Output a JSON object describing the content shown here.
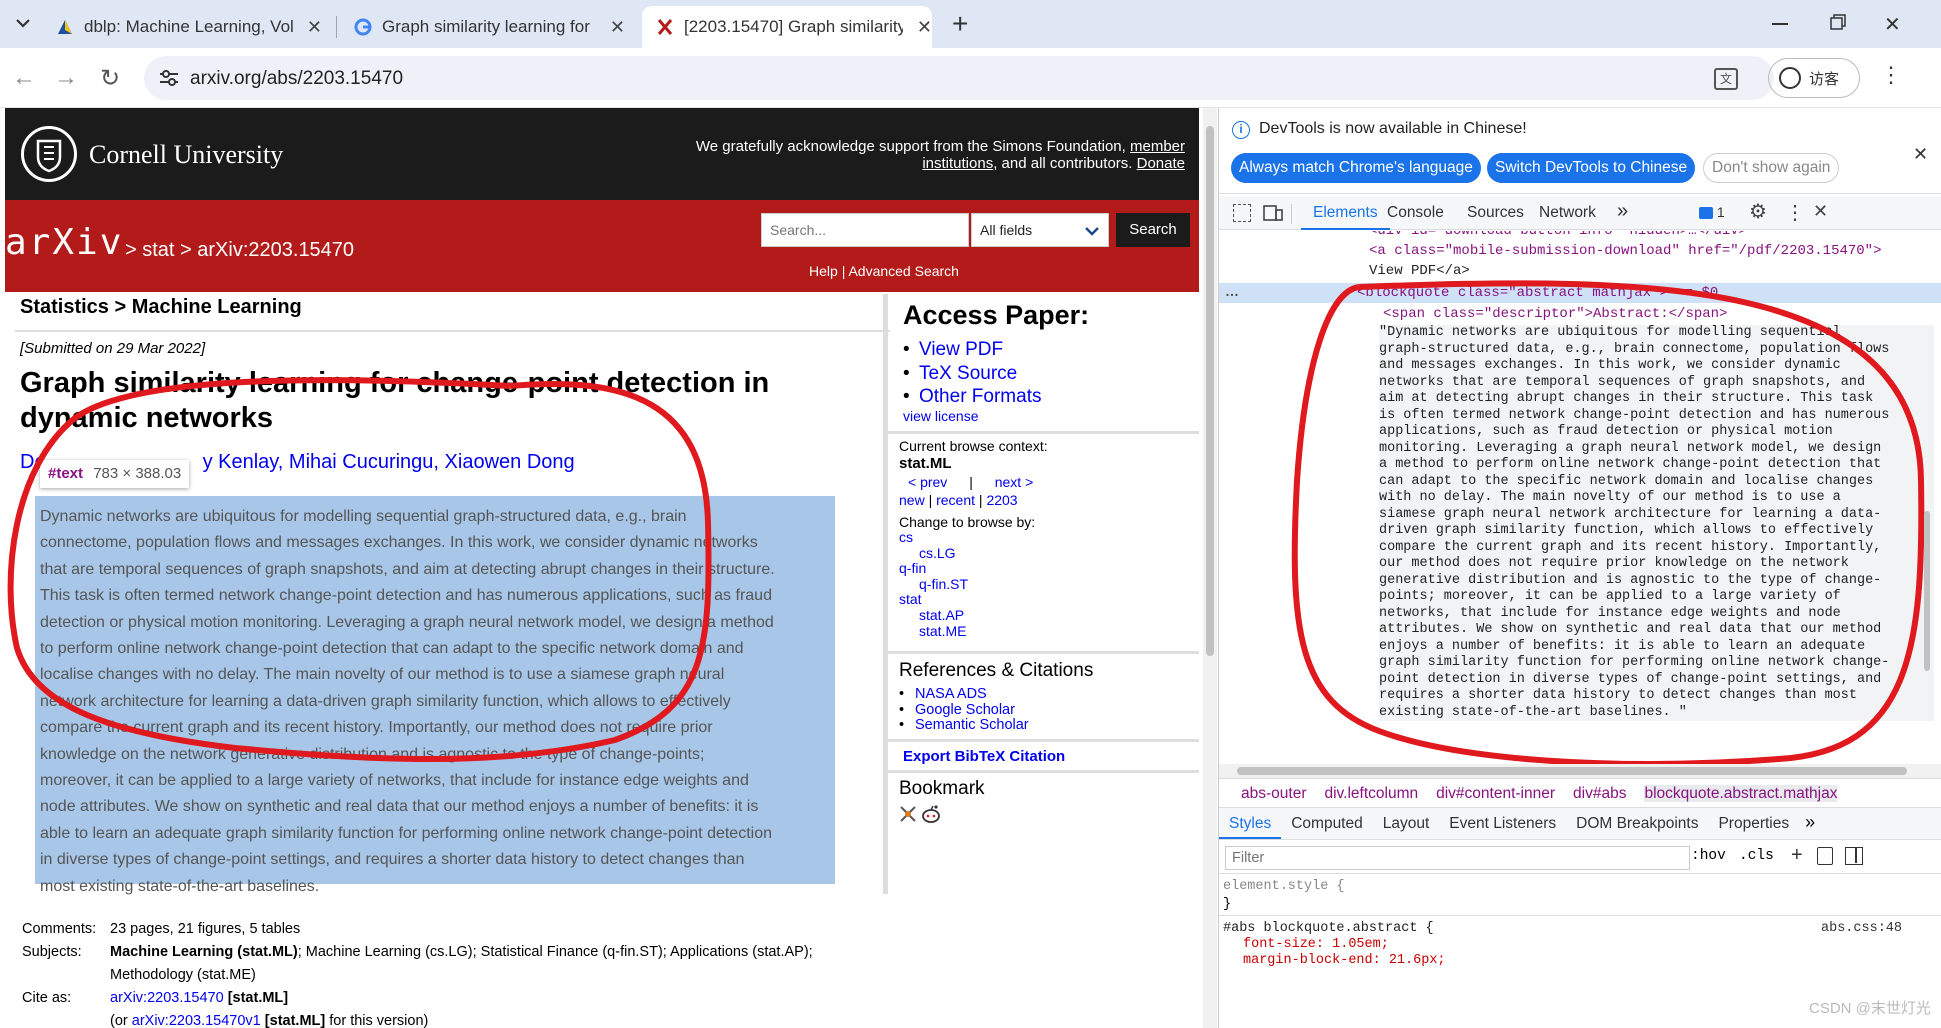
{
  "browser": {
    "tabs": [
      {
        "title": "dblp: Machine Learning, Volu",
        "active": false
      },
      {
        "title": "Graph similarity learning for",
        "active": false
      },
      {
        "title": "[2203.15470] Graph similarity",
        "active": true
      }
    ],
    "url": "arxiv.org/abs/2203.15470",
    "guest_label": "访客",
    "new_tab": "+"
  },
  "page": {
    "cornell_name": "Cornell University",
    "support_text_1": "We gratefully acknowledge support from the Simons Foundation,",
    "support_link_1": "member",
    "support_link_2": "institutions",
    "support_text_2": ", and all contributors.",
    "donate": "Donate",
    "arxiv_logo": "arXiv",
    "breadcrumb": "> stat > arXiv:2203.15470",
    "search_placeholder": "Search...",
    "search_field": "All fields",
    "search_button": "Search",
    "help": "Help",
    "help_sep": "|",
    "advanced_search": "Advanced Search",
    "subject_header": "Statistics > Machine Learning",
    "submitted": "[Submitted on 29 Mar 2022]",
    "title": "Graph similarity learning for change-point detection in dynamic networks",
    "authors_prefix": "De",
    "authors_tail": "y Kenlay, Mihai Cucuringu, Xiaowen Dong",
    "inspect_tooltip_tag": "#text",
    "inspect_tooltip_size": "783 × 388.03",
    "abstract": "Dynamic networks are ubiquitous for modelling sequential graph-structured data, e.g., brain connectome, population flows and messages exchanges. In this work, we consider dynamic networks that are temporal sequences of graph snapshots, and aim at detecting abrupt changes in their structure. This task is often termed network change-point detection and has numerous applications, such as fraud detection or physical motion monitoring. Leveraging a graph neural network model, we design a method to perform online network change-point detection that can adapt to the specific network domain and localise changes with no delay. The main novelty of our method is to use a siamese graph neural network architecture for learning a data-driven graph similarity function, which allows to effectively compare the current graph and its recent history. Importantly, our method does not require prior knowledge on the network generative distribution and is agnostic to the type of change-points; moreover, it can be applied to a large variety of networks, that include for instance edge weights and node attributes. We show on synthetic and real data that our method enjoys a number of benefits: it is able to learn an adequate graph similarity function for performing online network change-point detection in diverse types of change-point settings, and requires a shorter data history to detect changes than most existing state-of-the-art baselines.",
    "abstract_lines": [
      "Dynamic networks are ubiquitous for modelling sequential graph-structured data, e.g., brain",
      "connectome, population flows and messages exchanges. In this work, we consider dynamic networks",
      "that are temporal sequences of graph snapshots, and aim at detecting abrupt changes in their structure.",
      "This task is often termed network change-point detection and has numerous applications, such as fraud",
      "detection or physical motion monitoring. Leveraging a graph neural network model, we design a method",
      "to perform online network change-point detection that can adapt to the specific network domain and",
      "localise changes with no delay. The main novelty of our method is to use a siamese graph neural",
      "network architecture for learning a data-driven graph similarity function, which allows to effectively",
      "compare the current graph and its recent history. Importantly, our method does not require prior",
      "knowledge on the network generative distribution and is agnostic to the type of change-points;",
      "moreover, it can be applied to a large variety of networks, that include for instance edge weights and",
      "node attributes. We show on synthetic and real data that our method enjoys a number of benefits: it is",
      "able to learn an adequate graph similarity function for performing online network change-point detection",
      "in diverse types of change-point settings, and requires a shorter data history to detect changes than",
      "most existing state-of-the-art baselines."
    ],
    "meta": {
      "comments_label": "Comments:",
      "comments_value": "23 pages, 21 figures, 5 tables",
      "subjects_label": "Subjects:",
      "subjects_bold": "Machine Learning (stat.ML)",
      "subjects_rest": "; Machine Learning (cs.LG); Statistical Finance (q-fin.ST); Applications (stat.AP);",
      "subjects_line2": "Methodology (stat.ME)",
      "cite_label": "Cite as:",
      "cite_link": "arXiv:2203.15470",
      "cite_bold": "[stat.ML]",
      "cite2_prefix": "(or",
      "cite2_link": "arXiv:2203.15470v1",
      "cite2_bold": "[stat.ML]",
      "cite2_rest": "for this version)"
    },
    "sidebar": {
      "access_title": "Access Paper:",
      "access_links": [
        "View PDF",
        "TeX Source",
        "Other Formats"
      ],
      "view_license": "view license",
      "browse_context_label": "Current browse context:",
      "browse_context": "stat.ML",
      "prev": "< prev",
      "prev_sep": "|",
      "next": "next >",
      "new": "new",
      "recent": "recent",
      "year": "2203",
      "change_browse": "Change to browse by:",
      "browse_items": [
        {
          "text": "cs",
          "indent": false
        },
        {
          "text": "cs.LG",
          "indent": true
        },
        {
          "text": "q-fin",
          "indent": false
        },
        {
          "text": "q-fin.ST",
          "indent": true
        },
        {
          "text": "stat",
          "indent": false
        },
        {
          "text": "stat.AP",
          "indent": true
        },
        {
          "text": "stat.ME",
          "indent": true
        }
      ],
      "refs_title": "References & Citations",
      "refs_links": [
        "NASA ADS",
        "Google Scholar",
        "Semantic Scholar"
      ],
      "export_bibtex": "Export BibTeX Citation",
      "bookmark": "Bookmark"
    }
  },
  "devtools": {
    "banner_text": "DevTools is now available in Chinese!",
    "banner_btn1": "Always match Chrome's language",
    "banner_btn2": "Switch DevTools to Chinese",
    "banner_btn3": "Don't show again",
    "tabs": [
      "Elements",
      "Console",
      "Sources",
      "Network"
    ],
    "more_tabs": "»",
    "issues_count": "1",
    "dom_lines": [
      "<div id=\"download-button-info\" hidden>…</div>",
      "<a class=\"mobile-submission-download\" href=\"/pdf/2203.15470\">",
      "View PDF</a>",
      "<blockquote class=\"abstract mathjax\"> == $0",
      "<span class=\"descriptor\">Abstract:</span>"
    ],
    "dom_text_lines": [
      "\"Dynamic networks are ubiquitous for modelling sequential",
      "graph-structured data, e.g., brain connectome, population flows",
      "and messages exchanges. In this work, we consider dynamic",
      "networks that are temporal sequences of graph snapshots, and",
      "aim at detecting abrupt changes in their structure. This task",
      "is often termed network change-point detection and has numerous",
      "applications, such as fraud detection or physical motion",
      "monitoring. Leveraging a graph neural network model, we design",
      "a method to perform online network change-point detection that",
      "can adapt to the specific network domain and localise changes",
      "with no delay. The main novelty of our method is to use a",
      "siamese graph neural network architecture for learning a data-",
      "driven graph similarity function, which allows to effectively",
      "compare the current graph and its recent history. Importantly,",
      "our method does not require prior knowledge on the network",
      "generative distribution and is agnostic to the type of change-",
      "points; moreover, it can be applied to a large variety of",
      "networks, that include for instance edge weights and node",
      "attributes. We show on synthetic and real data that our method",
      "enjoys a number of benefits: it is able to learn an adequate",
      "graph similarity function for performing online network change-",
      "point detection in diverse types of change-point settings, and",
      "requires a shorter data history to detect changes than most",
      "existing state-of-the-art baselines. \""
    ],
    "breadcrumbs": [
      "abs-outer",
      "div.leftcolumn",
      "div#content-inner",
      "div#abs",
      "blockquote.abstract.mathjax"
    ],
    "style_tabs": [
      "Styles",
      "Computed",
      "Layout",
      "Event Listeners",
      "DOM Breakpoints",
      "Properties"
    ],
    "filter_placeholder": "Filter",
    "hov": ":hov",
    "cls": ".cls",
    "element_style": "element.style {",
    "close_brace": "}",
    "rule_selector": "#abs blockquote.abstract {",
    "rule_source": "abs.css:48",
    "rule_prop1": "font-size: 1.05em;",
    "rule_prop2": "margin-block-end: 21.6px;"
  },
  "watermark": "CSDN @末世灯光",
  "colors": {
    "arxiv_red": "#b31b1b",
    "cornell_black": "#1b1b1b",
    "selection_blue": "#a8c7e8",
    "annotation_red": "#e0191e",
    "devtools_blue": "#1a73e8"
  }
}
